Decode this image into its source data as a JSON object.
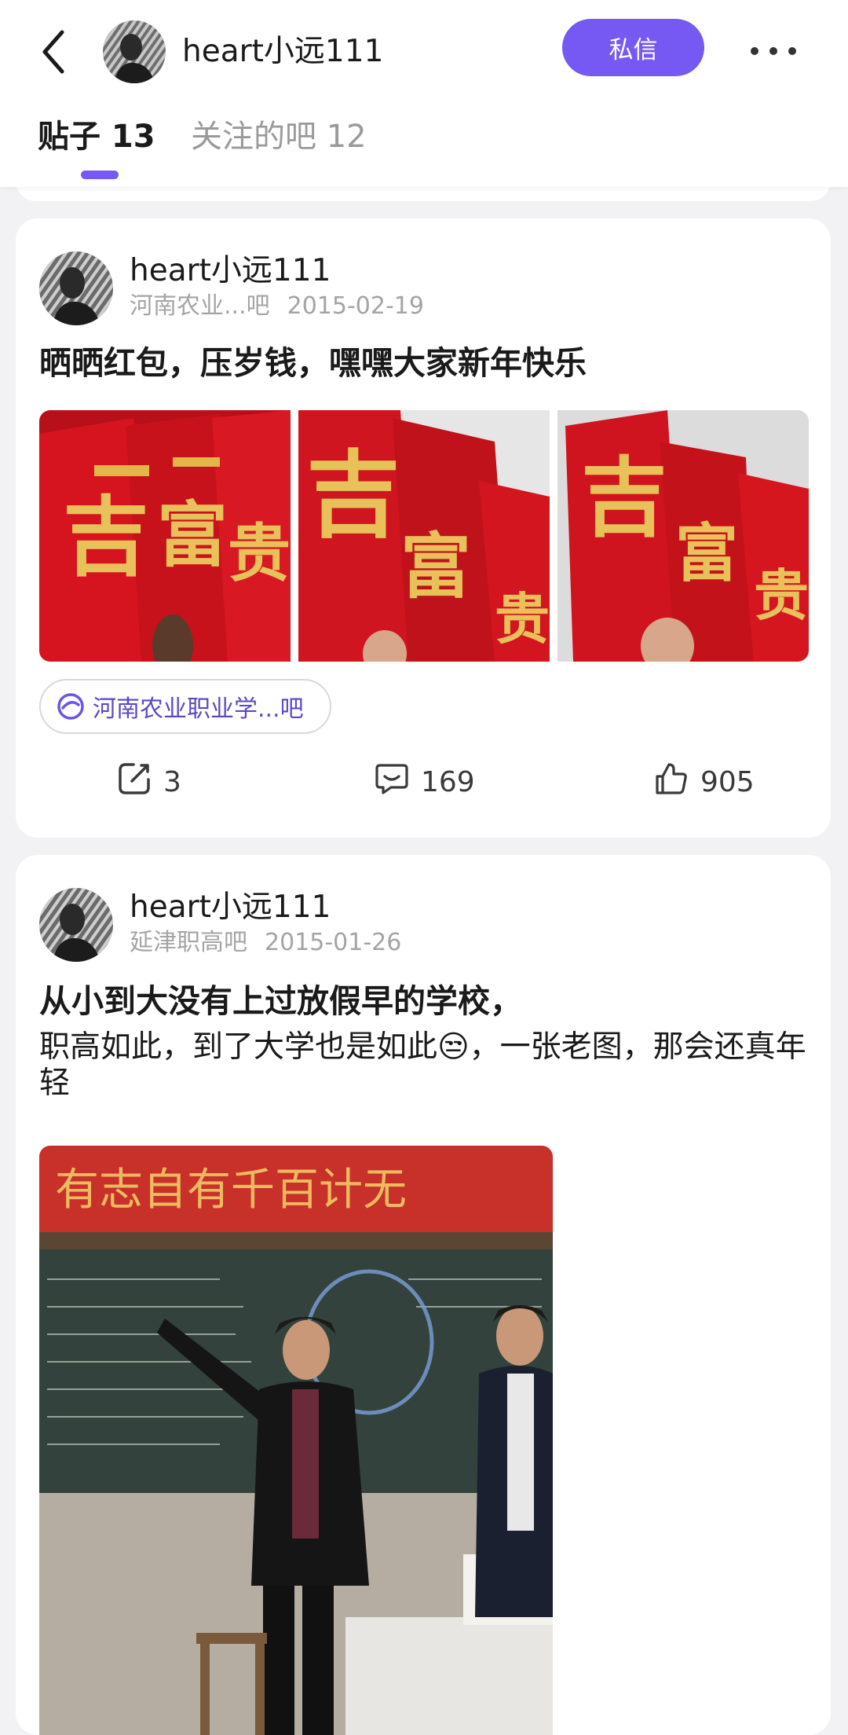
{
  "header": {
    "username": "heart小远111",
    "dm_label": "私信",
    "tabs": [
      {
        "label": "贴子 13",
        "active": true
      },
      {
        "label": "关注的吧 12",
        "active": false
      }
    ]
  },
  "posts": [
    {
      "author": "heart小远111",
      "forum": "河南农业...吧",
      "date": "2015-02-19",
      "title": "晒晒红包，压岁钱，嘿嘿大家新年快乐",
      "images": [
        "red-envelopes-photo-1",
        "red-envelopes-photo-2",
        "red-envelopes-photo-3"
      ],
      "forum_chip": "河南农业职业学...吧",
      "shares": "3",
      "comments": "169",
      "likes": "905"
    },
    {
      "author": "heart小远111",
      "forum": "延津职高吧",
      "date": "2015-01-26",
      "title": "从小到大没有上过放假早的学校，",
      "body": "职高如此，到了大学也是如此😒，一张老图，那会还真年轻",
      "images": [
        "classroom-photo"
      ]
    }
  ],
  "colors": {
    "accent": "#7559f2",
    "text": "#1a1a1a",
    "muted": "#a4a4a4",
    "background": "#f2f2f4"
  },
  "icons": [
    "back-arrow-icon",
    "more-dots-icon",
    "share-icon",
    "comment-icon",
    "like-icon",
    "forum-icon"
  ]
}
